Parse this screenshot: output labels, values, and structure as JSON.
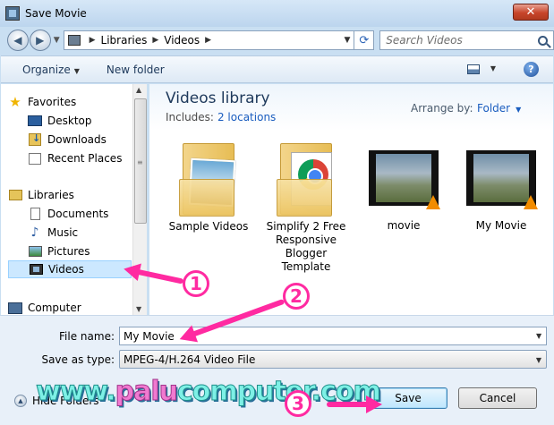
{
  "window": {
    "title": "Save Movie",
    "close_label": "✕"
  },
  "address": {
    "segments": [
      "Libraries",
      "Videos"
    ]
  },
  "search": {
    "placeholder": "Search Videos"
  },
  "toolbar": {
    "organize_label": "Organize",
    "new_folder_label": "New folder"
  },
  "sidebar": {
    "items": [
      {
        "label": "Favorites",
        "icon": "star-icon"
      },
      {
        "label": "Desktop",
        "icon": "desktop-icon"
      },
      {
        "label": "Downloads",
        "icon": "downloads-icon"
      },
      {
        "label": "Recent Places",
        "icon": "recent-places-icon"
      },
      {
        "label": "Libraries",
        "icon": "libraries-icon"
      },
      {
        "label": "Documents",
        "icon": "documents-icon"
      },
      {
        "label": "Music",
        "icon": "music-icon"
      },
      {
        "label": "Pictures",
        "icon": "pictures-icon"
      },
      {
        "label": "Videos",
        "icon": "videos-icon",
        "selected": true
      },
      {
        "label": "Computer",
        "icon": "computer-icon"
      }
    ]
  },
  "library": {
    "title": "Videos library",
    "includes_label": "Includes:",
    "includes_link": "2 locations",
    "arrange_label": "Arrange by:",
    "arrange_value": "Folder"
  },
  "files": [
    {
      "name": "Sample Videos",
      "kind": "folder-photo"
    },
    {
      "name": "Simplify 2 Free Responsive Blogger Template",
      "kind": "folder-chrome"
    },
    {
      "name": "movie",
      "kind": "video"
    },
    {
      "name": "My Movie",
      "kind": "video"
    }
  ],
  "form": {
    "filename_label": "File name:",
    "filename_value": "My Movie",
    "savetype_label": "Save as type:",
    "savetype_value": "MPEG-4/H.264 Video File"
  },
  "footer": {
    "hide_folders_label": "Hide Folders",
    "save_label": "Save",
    "cancel_label": "Cancel"
  },
  "watermark": {
    "part1": "www.",
    "part2": "palu",
    "part3": "computer.com"
  },
  "annotations": {
    "step1": "1",
    "step2": "2",
    "step3": "3"
  },
  "colors": {
    "accent": "#ff2aa1",
    "link": "#1a5dbf",
    "selection": "#cce8ff"
  }
}
